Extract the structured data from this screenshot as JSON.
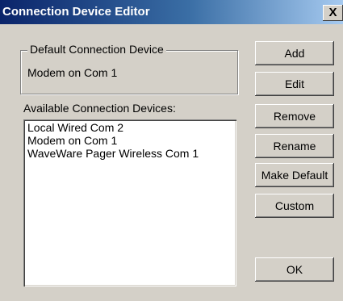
{
  "window": {
    "title": "Connection Device Editor",
    "close_label": "X"
  },
  "default_group": {
    "legend": "Default Connection Device",
    "value": "Modem on Com 1"
  },
  "devices": {
    "label": "Available Connection Devices:",
    "items": [
      "Local Wired Com 2",
      "Modem on Com 1",
      "WaveWare Pager Wireless Com 1"
    ]
  },
  "buttons": {
    "add": "Add",
    "edit": "Edit",
    "remove": "Remove",
    "rename": "Rename",
    "make_default": "Make Default",
    "custom": "Custom",
    "ok": "OK"
  },
  "colors": {
    "titlebar_start": "#0a246a",
    "titlebar_end": "#a6caf0",
    "dialog_face": "#d4d0c8"
  }
}
